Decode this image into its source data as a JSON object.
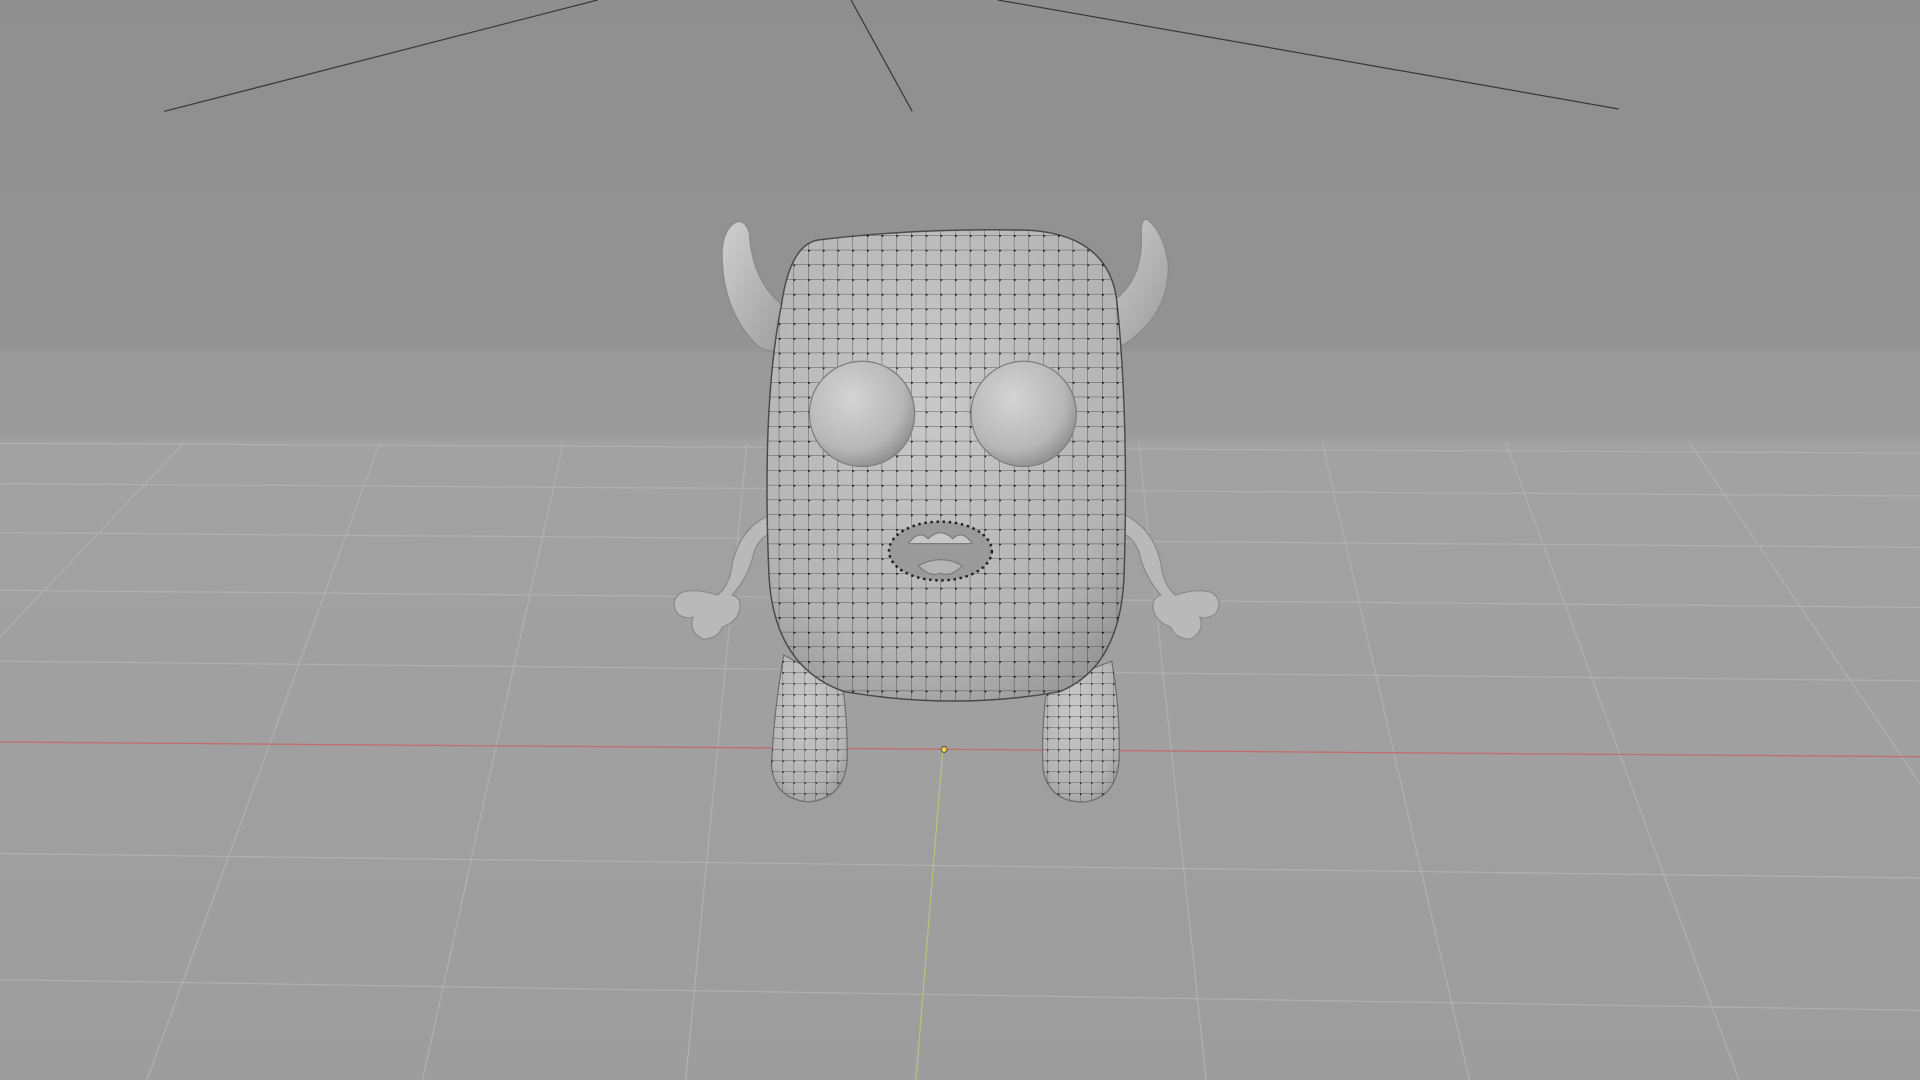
{
  "app": {
    "kind": "3d-viewport",
    "mode_hint": "edit-mode-mesh-vertices-visible"
  },
  "scene": {
    "background_top_color": "#8f8f8f",
    "background_mid_color": "#979797",
    "floor_color": "#a3a3a3",
    "grid_color": "#b3b3b3",
    "x_axis_color": "#c46a6a",
    "y_axis_color": "#b8c27a",
    "mesh_fill_color": "#bdbdbd",
    "mesh_shadow_color": "#8c8c8c",
    "wire_color": "#2a2a2a",
    "vertex_color": "#000000",
    "origin_color": "#e6c84b"
  },
  "objects": [
    {
      "name": "monster-body",
      "icon": "mesh-object-icon"
    },
    {
      "name": "monster-horns",
      "icon": "horn-icon"
    },
    {
      "name": "monster-eyes",
      "icon": "eye-icon"
    },
    {
      "name": "monster-arms",
      "icon": "arm-icon"
    },
    {
      "name": "monster-legs",
      "icon": "leg-icon"
    }
  ]
}
